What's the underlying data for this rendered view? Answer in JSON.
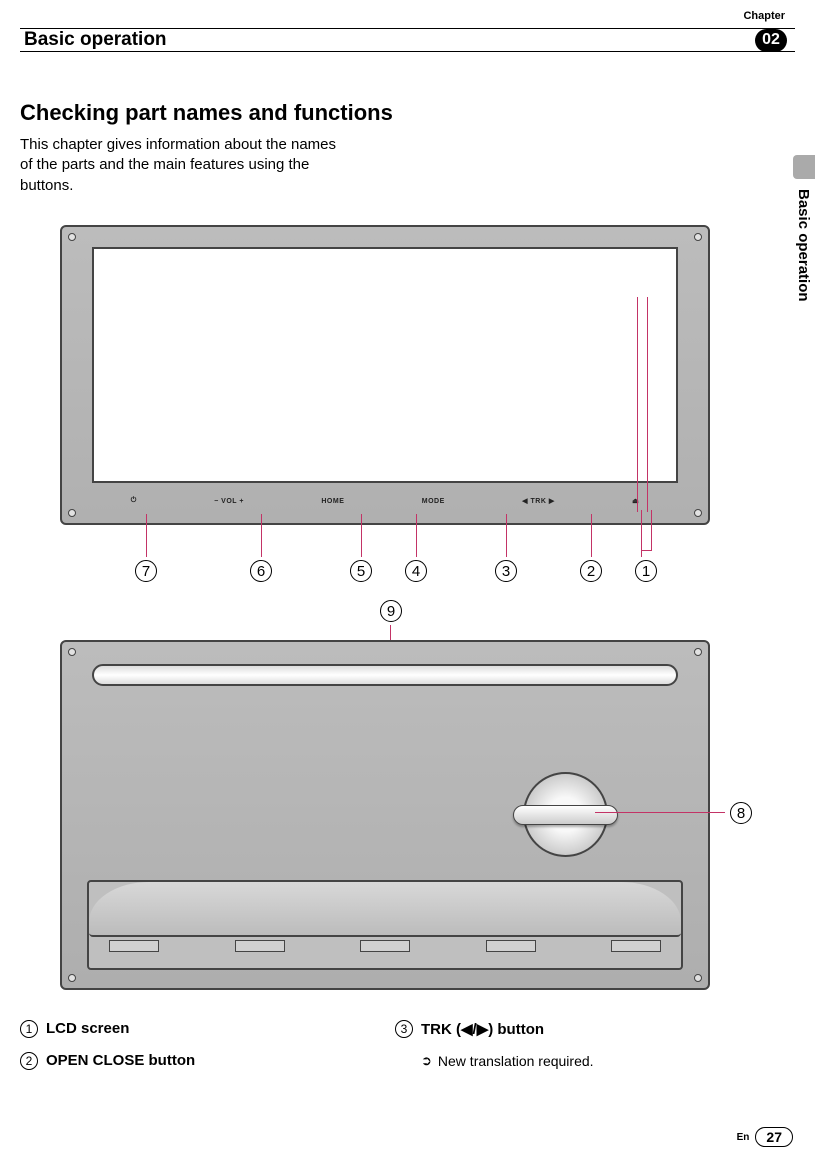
{
  "chapter": {
    "label": "Chapter",
    "number": "02"
  },
  "header": {
    "title": "Basic operation"
  },
  "side_tab": {
    "text": "Basic operation"
  },
  "section": {
    "title": "Checking part names and functions",
    "intro": "This chapter gives information about the names of the parts and the main features using the buttons."
  },
  "diagram1": {
    "buttons": {
      "power": "⏻",
      "vol_minus": "−",
      "vol_label": "VOL",
      "vol_plus": "+",
      "home": "HOME",
      "mode": "MODE",
      "trk_prev": "◀",
      "trk_label": "TRK",
      "trk_next": "▶",
      "eject": "⏏"
    },
    "callouts": [
      "7",
      "6",
      "5",
      "4",
      "3",
      "2",
      "1"
    ]
  },
  "diagram2": {
    "callouts": {
      "top": "9",
      "right": "8"
    }
  },
  "list": {
    "left": [
      {
        "num": "1",
        "title": "LCD screen"
      },
      {
        "num": "2",
        "title": "OPEN CLOSE button"
      }
    ],
    "right": [
      {
        "num": "3",
        "title": "TRK (◀/▶) button",
        "sub": "New translation required."
      }
    ]
  },
  "footer": {
    "lang": "En",
    "page": "27"
  }
}
